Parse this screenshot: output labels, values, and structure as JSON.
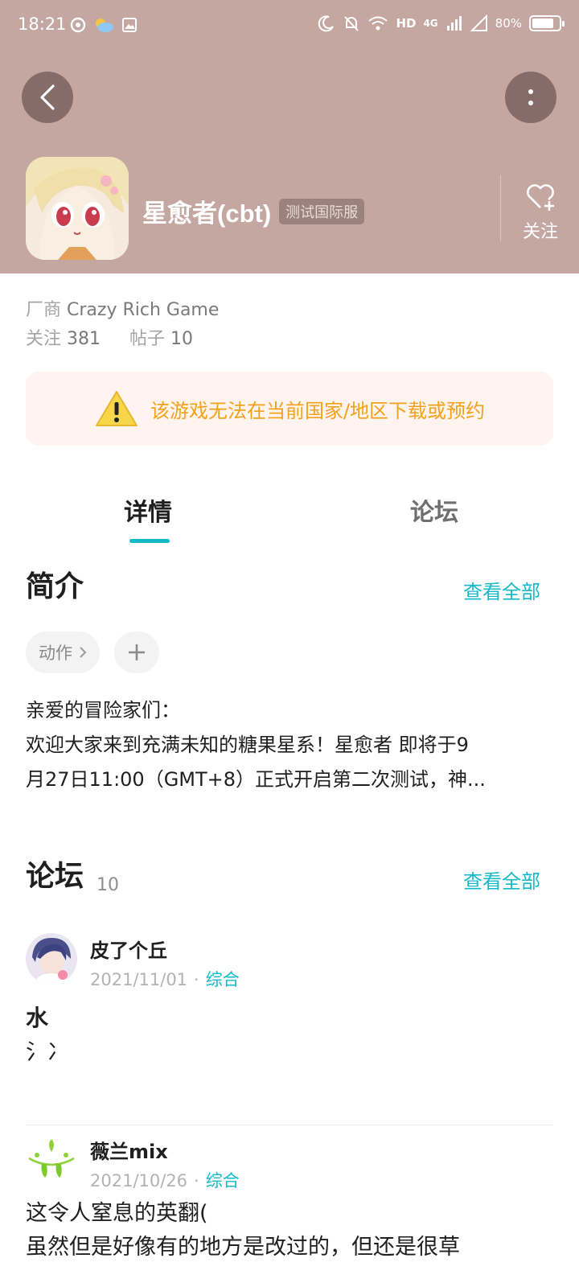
{
  "status_bar": {
    "time": "18:21",
    "network": "4G",
    "battery": "80%",
    "battery_level": 0.8
  },
  "header": {
    "game_name": "星愈者(cbt)",
    "server_badge": "测试国际服",
    "follow_label": "关注",
    "background_color": "#c5a7a1"
  },
  "info": {
    "developer_label": "厂商",
    "developer": "Crazy Rich Game",
    "followers_label": "关注",
    "followers": "381",
    "posts_label": "帖子",
    "posts": "10"
  },
  "warning": {
    "text": "该游戏无法在当前国家/地区下载或预约"
  },
  "tabs": [
    {
      "label": "详情",
      "active": true
    },
    {
      "label": "论坛",
      "active": false
    }
  ],
  "intro": {
    "title": "简介",
    "see_all": "查看全部",
    "tag": "动作",
    "text_line1": "亲爱的冒险家们：",
    "text_line2": "欢迎大家来到充满未知的糖果星系！星愈者 即将于9",
    "text_line3": "月27日11:00（GMT+8）正式开启第二次测试，神..."
  },
  "forum": {
    "title": "论坛",
    "count": "10",
    "see_all": "查看全部",
    "posts": [
      {
        "author": "皮了个丘",
        "date": "2021/11/01",
        "category": "综合",
        "title": "水",
        "body": "氵冫"
      },
      {
        "author": "薇兰mix",
        "date": "2021/10/26",
        "category": "综合",
        "title": "",
        "body_line1": "这令人窒息的英翻(",
        "body_line2": "虽然但是好像有的地方是改过的，但还是很草"
      }
    ]
  },
  "colors": {
    "accent": "#14b9c8",
    "warning_text": "#f4a21c",
    "warning_bg": "#fff4f0"
  }
}
